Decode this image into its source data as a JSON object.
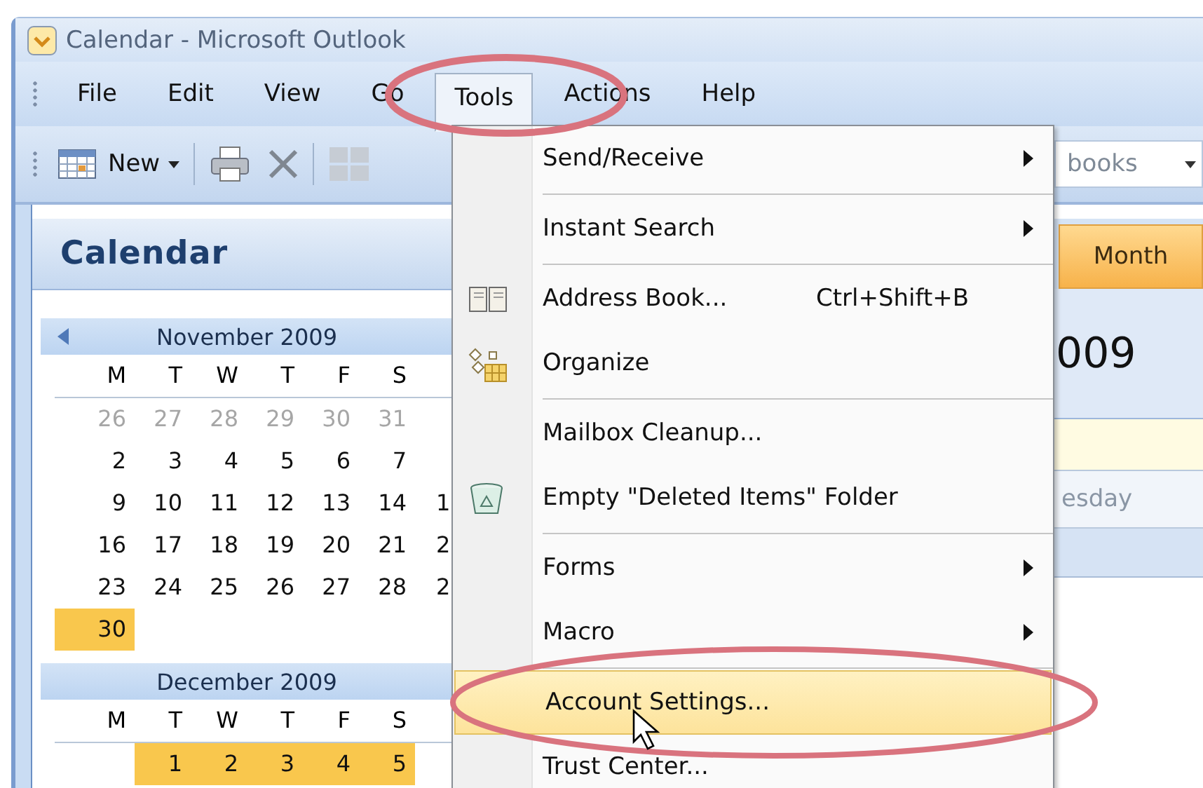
{
  "window": {
    "title": "Calendar - Microsoft Outlook"
  },
  "menu_bar": [
    {
      "label": "File",
      "selected": false
    },
    {
      "label": "Edit",
      "selected": false
    },
    {
      "label": "View",
      "selected": false
    },
    {
      "label": "Go",
      "selected": false
    },
    {
      "label": "Tools",
      "selected": true
    },
    {
      "label": "Actions",
      "selected": false
    },
    {
      "label": "Help",
      "selected": false
    }
  ],
  "toolbar": {
    "new_button": "New",
    "search_field": {
      "placeholder": "books"
    }
  },
  "navigation_pane": {
    "title": "Calendar",
    "months": [
      {
        "title": "November 2009",
        "weekdays": [
          "M",
          "T",
          "W",
          "T",
          "F",
          "S"
        ],
        "weeks": [
          {
            "days": [
              {
                "label": "26",
                "muted": true,
                "selected": false
              },
              {
                "label": "27",
                "muted": true,
                "selected": false
              },
              {
                "label": "28",
                "muted": true,
                "selected": false
              },
              {
                "label": "29",
                "muted": true,
                "selected": false
              },
              {
                "label": "30",
                "muted": true,
                "selected": false
              },
              {
                "label": "31",
                "muted": true,
                "selected": false
              }
            ]
          },
          {
            "days": [
              {
                "label": "2",
                "muted": false,
                "selected": false
              },
              {
                "label": "3",
                "muted": false,
                "selected": false
              },
              {
                "label": "4",
                "muted": false,
                "selected": false
              },
              {
                "label": "5",
                "muted": false,
                "selected": false
              },
              {
                "label": "6",
                "muted": false,
                "selected": false
              },
              {
                "label": "7",
                "muted": false,
                "selected": false
              }
            ]
          },
          {
            "days": [
              {
                "label": "9",
                "muted": false,
                "selected": false
              },
              {
                "label": "10",
                "muted": false,
                "selected": false
              },
              {
                "label": "11",
                "muted": false,
                "selected": false
              },
              {
                "label": "12",
                "muted": false,
                "selected": false
              },
              {
                "label": "13",
                "muted": false,
                "selected": false
              },
              {
                "label": "14",
                "muted": false,
                "selected": false
              },
              {
                "label": "1",
                "muted": false,
                "selected": false
              }
            ]
          },
          {
            "days": [
              {
                "label": "16",
                "muted": false,
                "selected": false
              },
              {
                "label": "17",
                "muted": false,
                "selected": false
              },
              {
                "label": "18",
                "muted": false,
                "selected": false
              },
              {
                "label": "19",
                "muted": false,
                "selected": false
              },
              {
                "label": "20",
                "muted": false,
                "selected": false
              },
              {
                "label": "21",
                "muted": false,
                "selected": false
              },
              {
                "label": "2",
                "muted": false,
                "selected": false
              }
            ]
          },
          {
            "days": [
              {
                "label": "23",
                "muted": false,
                "selected": false
              },
              {
                "label": "24",
                "muted": false,
                "selected": false
              },
              {
                "label": "25",
                "muted": false,
                "selected": false
              },
              {
                "label": "26",
                "muted": false,
                "selected": false
              },
              {
                "label": "27",
                "muted": false,
                "selected": false
              },
              {
                "label": "28",
                "muted": false,
                "selected": false
              },
              {
                "label": "2",
                "muted": false,
                "selected": false
              }
            ]
          },
          {
            "days": [
              {
                "label": "30",
                "muted": false,
                "selected": true
              }
            ]
          }
        ]
      },
      {
        "title": "December 2009",
        "weekdays": [
          "M",
          "T",
          "W",
          "T",
          "F",
          "S"
        ],
        "weeks": [
          {
            "starts_blank": true,
            "days": [
              {
                "label": "1",
                "muted": false,
                "selected": true
              },
              {
                "label": "2",
                "muted": false,
                "selected": true
              },
              {
                "label": "3",
                "muted": false,
                "selected": true
              },
              {
                "label": "4",
                "muted": false,
                "selected": true
              },
              {
                "label": "5",
                "muted": false,
                "selected": true
              }
            ]
          }
        ]
      }
    ]
  },
  "view_tabs": [
    {
      "label": "Month",
      "selected": true
    }
  ],
  "date_heading": "009",
  "day_header": "esday",
  "tools_menu": [
    {
      "kind": "item",
      "label": "Send/Receive",
      "submenu": true,
      "selected": false
    },
    {
      "kind": "separator"
    },
    {
      "kind": "item",
      "label": "Instant Search",
      "submenu": true,
      "selected": false
    },
    {
      "kind": "separator"
    },
    {
      "kind": "item",
      "label": "Address Book...",
      "shortcut": "Ctrl+Shift+B",
      "submenu": false,
      "selected": false
    },
    {
      "kind": "item",
      "label": "Organize",
      "submenu": false,
      "selected": false
    },
    {
      "kind": "separator"
    },
    {
      "kind": "item",
      "label": "Mailbox Cleanup...",
      "submenu": false,
      "selected": false
    },
    {
      "kind": "item",
      "label": "Empty \"Deleted Items\" Folder",
      "submenu": false,
      "selected": false
    },
    {
      "kind": "separator"
    },
    {
      "kind": "item",
      "label": "Forms",
      "submenu": true,
      "selected": false
    },
    {
      "kind": "item",
      "label": "Macro",
      "submenu": true,
      "selected": false
    },
    {
      "kind": "separator"
    },
    {
      "kind": "item",
      "label": "Account Settings...",
      "submenu": false,
      "selected": true
    },
    {
      "kind": "item",
      "label": "Trust Center...",
      "submenu": false,
      "selected": false
    }
  ]
}
